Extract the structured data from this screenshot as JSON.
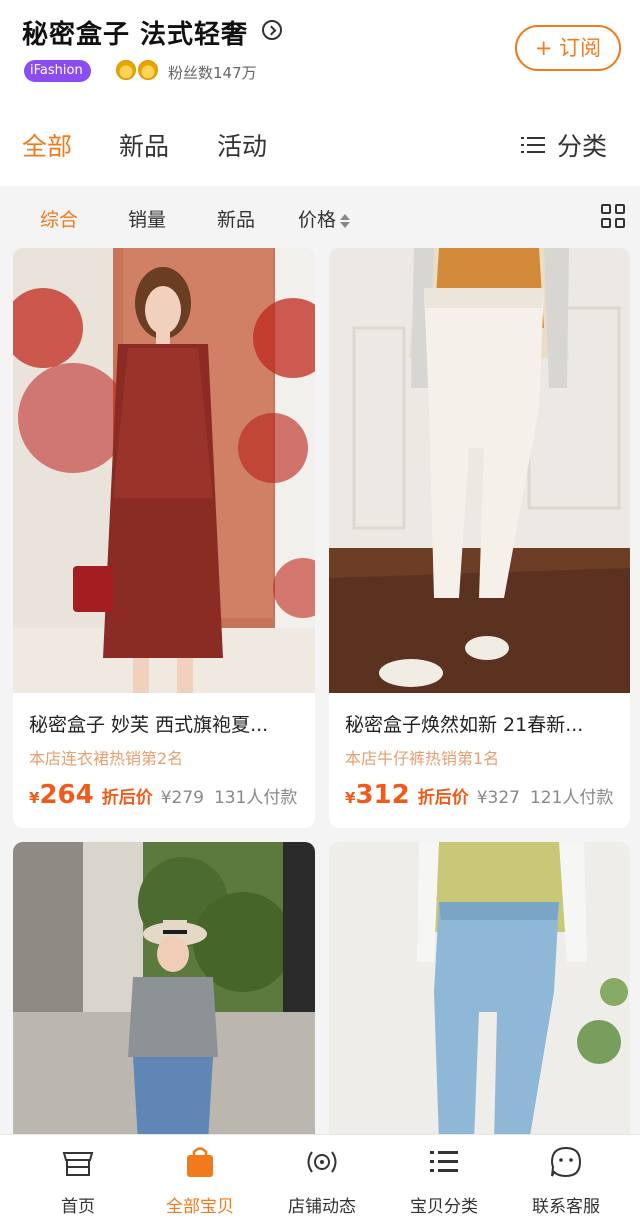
{
  "header": {
    "shop_name": "秘密盒子 法式轻奢",
    "badge": "iFashion",
    "fans": "粉丝数147万",
    "subscribe": "+ 订阅"
  },
  "tabs": {
    "all": "全部",
    "new": "新品",
    "activity": "活动",
    "category": "分类"
  },
  "filters": {
    "overall": "综合",
    "sales": "销量",
    "new": "新品",
    "price": "价格"
  },
  "products": [
    {
      "name": "秘密盒子 妙芙 西式旗袍夏...",
      "rank": "本店连衣裙热销第2名",
      "yen": "¥",
      "price": "264",
      "after_discount": "折后价",
      "original": "¥279",
      "buyers": "131人付款"
    },
    {
      "name": "秘密盒子焕然如新 21春新...",
      "rank": "本店牛仔裤热销第1名",
      "yen": "¥",
      "price": "312",
      "after_discount": "折后价",
      "original": "¥327",
      "buyers": "121人付款"
    },
    {
      "name": "",
      "rank": "",
      "price": ""
    },
    {
      "name": "",
      "rank": "",
      "price": ""
    }
  ],
  "bottom_nav": [
    {
      "label": "首页",
      "icon": "shop-home-icon"
    },
    {
      "label": "全部宝贝",
      "icon": "shopping-bag-icon"
    },
    {
      "label": "店铺动态",
      "icon": "live-feed-icon"
    },
    {
      "label": "宝贝分类",
      "icon": "category-list-icon"
    },
    {
      "label": "联系客服",
      "icon": "customer-service-icon"
    }
  ],
  "colors": {
    "accent": "#f07a1c",
    "price": "#f05a1a",
    "rank": "#e6a071",
    "badge": "#8b4df0"
  }
}
